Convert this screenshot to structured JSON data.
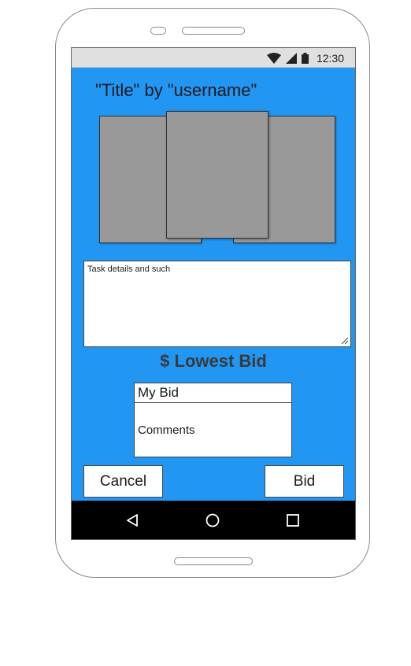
{
  "status_bar": {
    "time": "12:30",
    "icons": [
      "wifi-icon",
      "signal-icon",
      "battery-icon"
    ]
  },
  "task": {
    "title": "\"Title\" by \"username\"",
    "details": "Task details and such"
  },
  "bid": {
    "lowest_bid_symbol": "$",
    "lowest_bid_label": "Lowest Bid",
    "my_bid_value": "My Bid",
    "comments_value": "Comments"
  },
  "actions": {
    "cancel_label": "Cancel",
    "bid_label": "Bid"
  },
  "nav": {
    "icons": [
      "back-icon",
      "home-icon",
      "recents-icon"
    ]
  },
  "colors": {
    "screen_background": "#2196f3",
    "image_placeholder": "#999999",
    "nav_bar": "#000000"
  }
}
